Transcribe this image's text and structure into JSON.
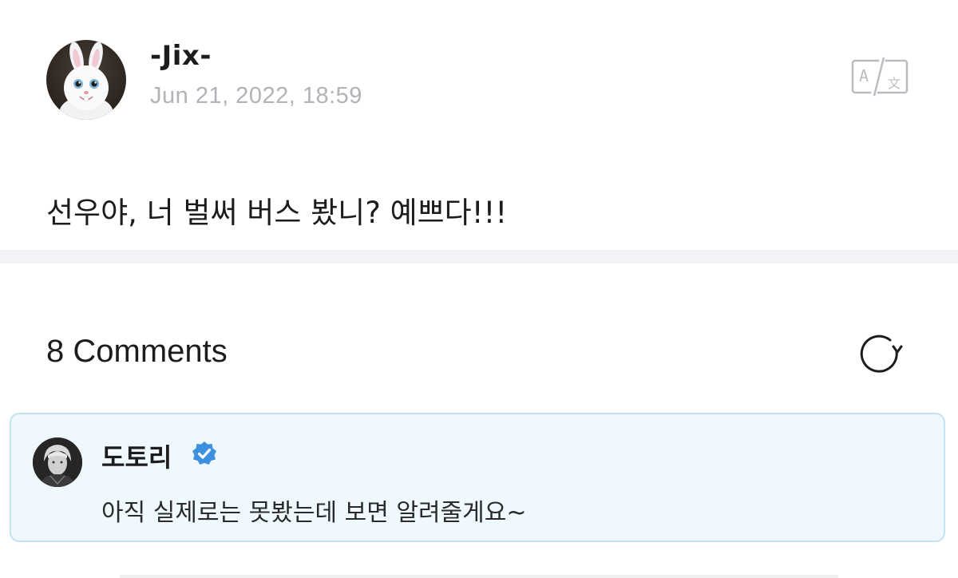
{
  "post": {
    "author": "-Jix-",
    "date": "Jun 21, 2022, 18:59",
    "body": "선우야, 너 벌써 버스 봤니? 예쁘다!!!",
    "translate_icon": "translate-icon"
  },
  "comments": {
    "title": "8 Comments",
    "refresh_icon": "refresh-icon",
    "items": [
      {
        "author": "도토리",
        "verified": true,
        "text": "아직 실제로는 못봤는데 보면 알려줄게요~"
      }
    ]
  },
  "colors": {
    "comment_background": "#eef8fd",
    "comment_border": "#c4e2ef",
    "verified_badge": "#3d8fe0",
    "date_text": "#b0b3b8",
    "divider": "#f3f2f6"
  }
}
